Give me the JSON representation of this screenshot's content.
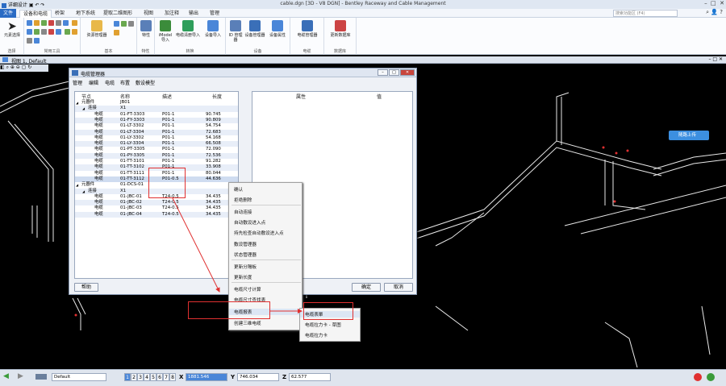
{
  "app": {
    "quick_access": "详细设计",
    "title": "cable.dgn [3D - V8 DGN] - Bentley Raceway and Cable Management",
    "search_placeholder": "搜索功能区 (F4)"
  },
  "tabs": [
    "文件",
    "设备和电缆",
    "桥架",
    "地下系统",
    "提取二维图形",
    "视图",
    "加注释",
    "输出",
    "管理"
  ],
  "ribbon": {
    "groups": [
      {
        "label": "选择",
        "buttons": [
          "元素选择"
        ]
      },
      {
        "label": "常用工具",
        "buttons": []
      },
      {
        "label": "基本",
        "buttons": [
          "资源管理器"
        ]
      },
      {
        "label": "特性",
        "buttons": [
          "特性"
        ]
      },
      {
        "label": "转换",
        "buttons": [
          "iModel 导入",
          "电缆清册导入",
          "设备导入"
        ]
      },
      {
        "label": "设备",
        "buttons": [
          "ID 管理器",
          "设备管理器",
          "设备属性"
        ]
      },
      {
        "label": "电缆",
        "buttons": [
          "电缆管理器"
        ]
      },
      {
        "label": "数据库",
        "buttons": [
          "更新数据库"
        ]
      }
    ]
  },
  "view": {
    "title": "视图 1, Default"
  },
  "dialog": {
    "title": "电缆管理器",
    "menu": [
      "管理",
      "编辑",
      "电缆",
      "布置",
      "敷设模型"
    ],
    "left_headers": [
      "节点",
      "名称",
      "描述",
      "长度"
    ],
    "right_headers": [
      "属性",
      "值"
    ],
    "rows": [
      {
        "node": "元器件",
        "name": "JB01",
        "desc": "",
        "len": "",
        "level": 1,
        "toggle": "◢"
      },
      {
        "node": "连接",
        "name": "X1",
        "desc": "",
        "len": "",
        "level": 2,
        "toggle": "◢"
      },
      {
        "node": "电缆",
        "name": "01-FT-3303",
        "desc": "P01-1",
        "len": "90.745",
        "level": 3
      },
      {
        "node": "电缆",
        "name": "01-FY-3303",
        "desc": "P01-1",
        "len": "90.809",
        "level": 3
      },
      {
        "node": "电缆",
        "name": "01-LT-3302",
        "desc": "P01-1",
        "len": "54.754",
        "level": 3
      },
      {
        "node": "电缆",
        "name": "01-LT-3304",
        "desc": "P01-1",
        "len": "72.683",
        "level": 3
      },
      {
        "node": "电缆",
        "name": "01-LY-3302",
        "desc": "P01-1",
        "len": "54.168",
        "level": 3
      },
      {
        "node": "电缆",
        "name": "01-LY-3304",
        "desc": "P01-1",
        "len": "66.508",
        "level": 3
      },
      {
        "node": "电缆",
        "name": "01-PT-3305",
        "desc": "P01-1",
        "len": "72.090",
        "level": 3
      },
      {
        "node": "电缆",
        "name": "01-PY-3305",
        "desc": "P01-1",
        "len": "72.536",
        "level": 3
      },
      {
        "node": "电缆",
        "name": "01-TT-3101",
        "desc": "P01-1",
        "len": "91.282",
        "level": 3
      },
      {
        "node": "电缆",
        "name": "01-TT-3102",
        "desc": "P01-1",
        "len": "33.908",
        "level": 3
      },
      {
        "node": "电缆",
        "name": "01-TT-3111",
        "desc": "P01-1",
        "len": "80.044",
        "level": 3
      },
      {
        "node": "电缆",
        "name": "01-TT-3112",
        "desc": "P01-0.5",
        "len": "44.636",
        "level": 3,
        "selected": true
      },
      {
        "node": "元器件",
        "name": "01-DCS-01",
        "desc": "",
        "len": "",
        "level": 1,
        "toggle": "◢"
      },
      {
        "node": "连接",
        "name": "X1",
        "desc": "",
        "len": "",
        "level": 2,
        "toggle": "◢"
      },
      {
        "node": "电缆",
        "name": "01-JBC-01",
        "desc": "T24-0.5",
        "len": "34.435",
        "level": 3
      },
      {
        "node": "电缆",
        "name": "01-JBC-02",
        "desc": "T24-0.5",
        "len": "34.435",
        "level": 3
      },
      {
        "node": "电缆",
        "name": "01-JBC-03",
        "desc": "T24-0.5",
        "len": "34.435",
        "level": 3
      },
      {
        "node": "电缆",
        "name": "01-JBC-04",
        "desc": "T24-0.5",
        "len": "34.435",
        "level": 3
      }
    ],
    "help_label": "帮助",
    "ok_label": "确定",
    "cancel_label": "取消"
  },
  "context_menu": {
    "items": [
      "确认",
      "拒绝删除",
      "自动连接",
      "自动敷设进入点",
      "持先检查自动敷设进入点",
      "敷设管理器",
      "状态管理器",
      "更新分隔板",
      "更新长度",
      "电缆尺寸计算",
      "电缆尺寸查找表",
      "电缆报表",
      "创建三维电缆"
    ],
    "submenu": [
      "电缆表單",
      "电缆拉力卡 - 草图",
      "电缆拉力卡"
    ]
  },
  "cloud_button": "随路上传",
  "status": {
    "level": "Default",
    "pages": [
      "1",
      "2",
      "3",
      "4",
      "5",
      "6",
      "7",
      "8"
    ],
    "x_label": "X",
    "x_value": "1881.546",
    "y_label": "Y",
    "y_value": "746.034",
    "z_label": "Z",
    "z_value": "62.577"
  },
  "colors": {
    "accent": "#2a6bc4",
    "annotation": "#e03030",
    "canvas": "#000000"
  }
}
